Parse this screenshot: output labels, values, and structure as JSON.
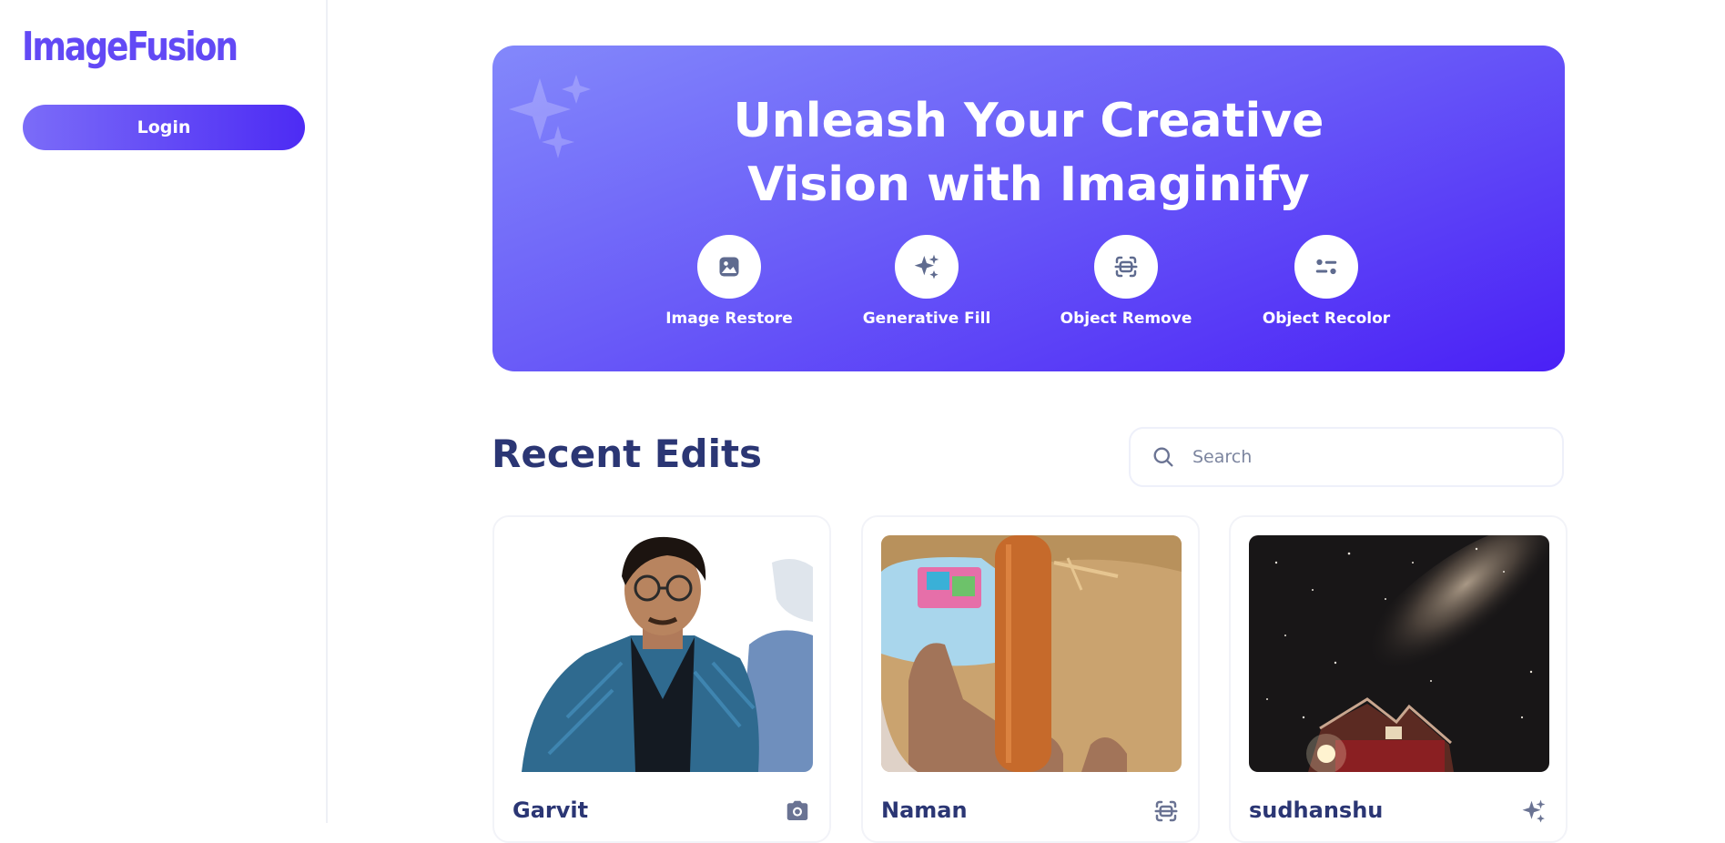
{
  "sidebar": {
    "logo": "ImageFusion",
    "login_label": "Login"
  },
  "banner": {
    "title_line1": "Unleash Your Creative",
    "title_line2": "Vision with Imaginify",
    "tools": [
      {
        "label": "Image Restore",
        "icon": "image-icon"
      },
      {
        "label": "Generative Fill",
        "icon": "sparkles-icon"
      },
      {
        "label": "Object Remove",
        "icon": "scan-icon"
      },
      {
        "label": "Object Recolor",
        "icon": "filter-icon"
      }
    ]
  },
  "recent": {
    "title": "Recent Edits",
    "search_placeholder": "Search",
    "cards": [
      {
        "title": "Garvit",
        "icon": "camera-icon"
      },
      {
        "title": "Naman",
        "icon": "scan-icon"
      },
      {
        "title": "sudhanshu",
        "icon": "sparkles-icon"
      }
    ]
  },
  "colors": {
    "brand": "#6249f5",
    "heading": "#2b3674",
    "banner_start": "#8388fb",
    "banner_end": "#4a20f6"
  }
}
